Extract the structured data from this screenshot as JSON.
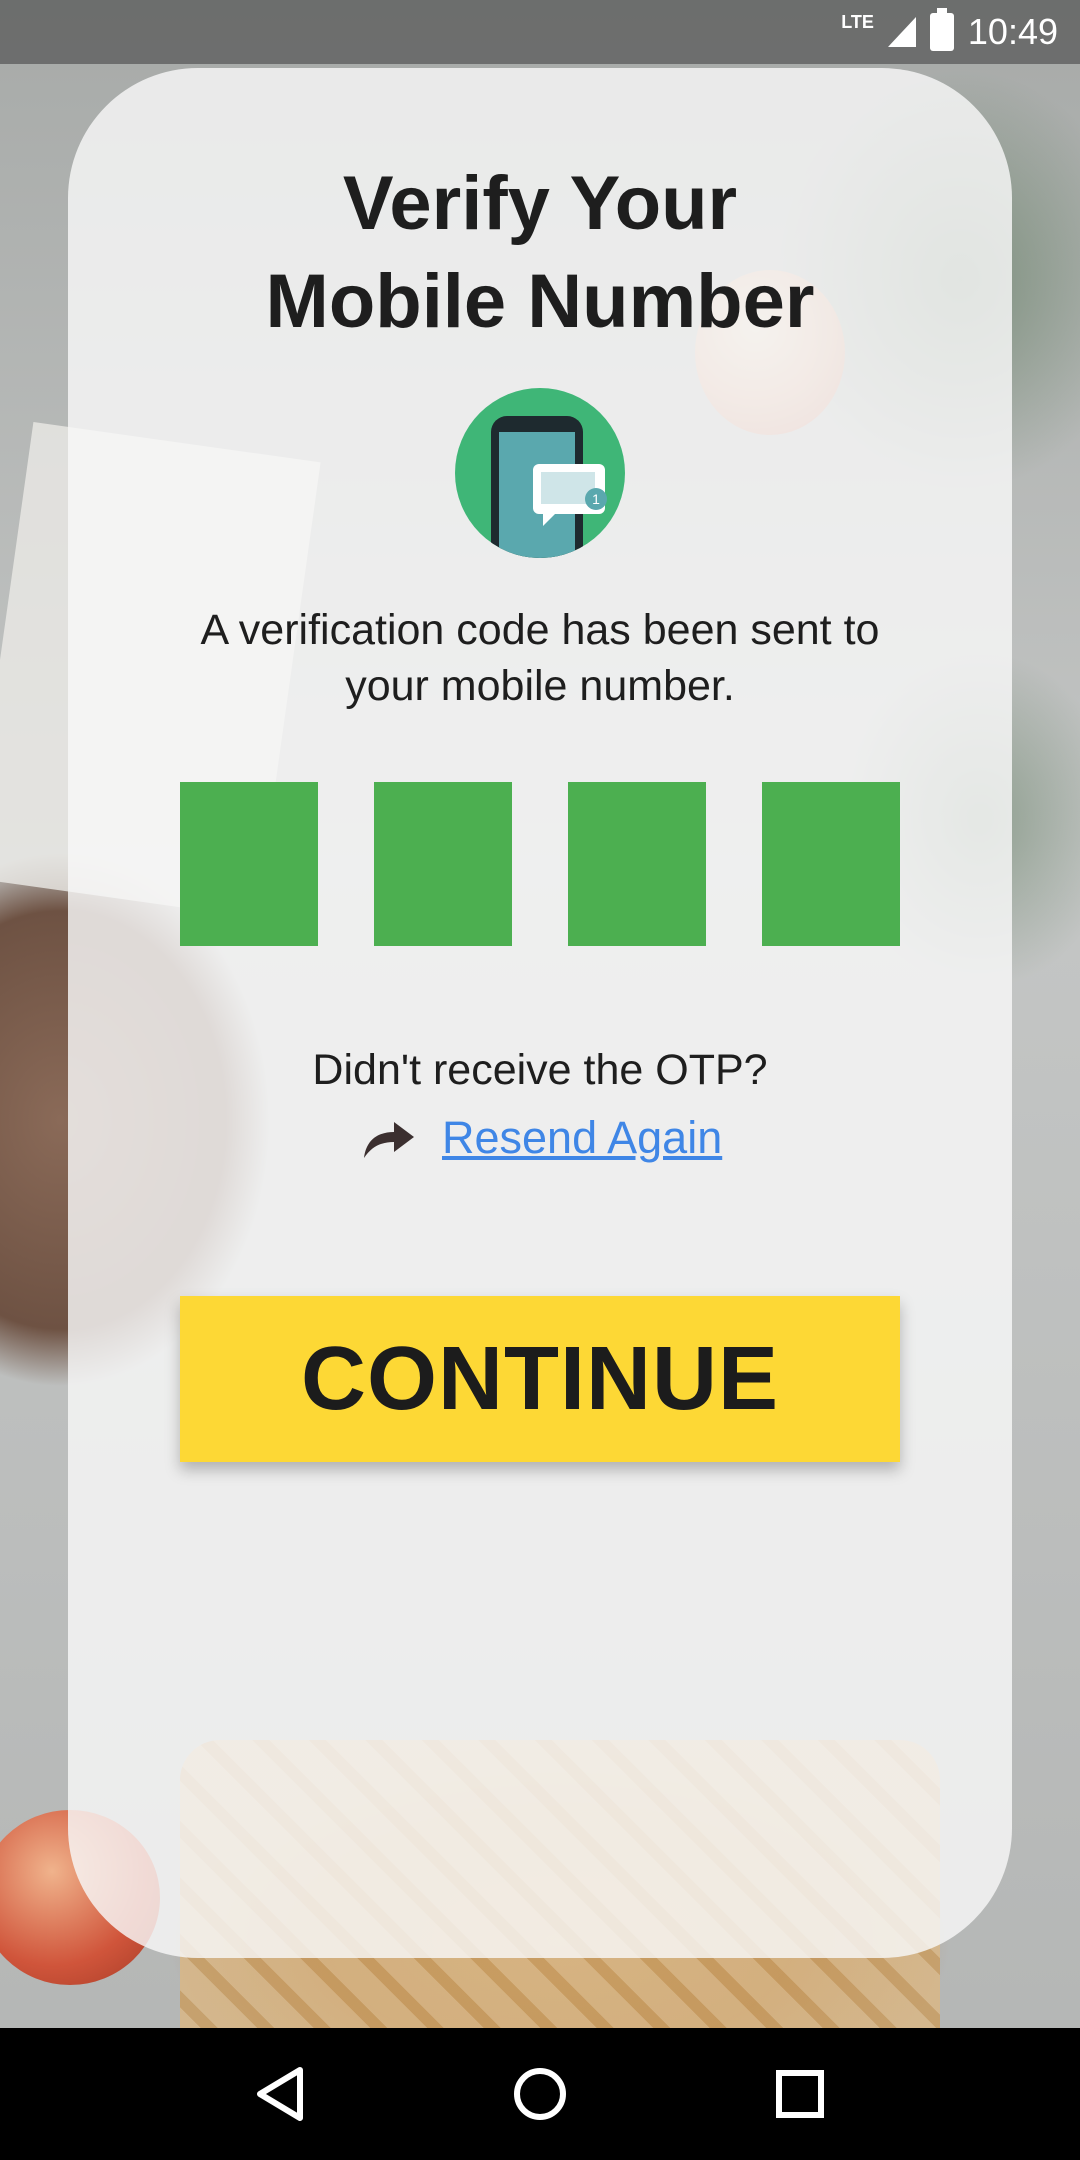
{
  "status_bar": {
    "network": "LTE",
    "time": "10:49"
  },
  "screen": {
    "title": "Verify Your Mobile Number",
    "message": "A verification code has been sent to your mobile number.",
    "otp": {
      "digits": [
        "",
        "",
        "",
        ""
      ],
      "box_color": "#4caf50"
    },
    "hint": "Didn't receive the OTP?",
    "resend_label": "Resend Again",
    "continue_label": "CONTINUE",
    "continue_color": "#fdd835"
  },
  "icons": {
    "illustration": "phone-message-icon",
    "resend": "share-arrow-icon"
  },
  "nav_bar": {
    "buttons": [
      "back-icon",
      "home-icon",
      "recents-icon"
    ]
  }
}
